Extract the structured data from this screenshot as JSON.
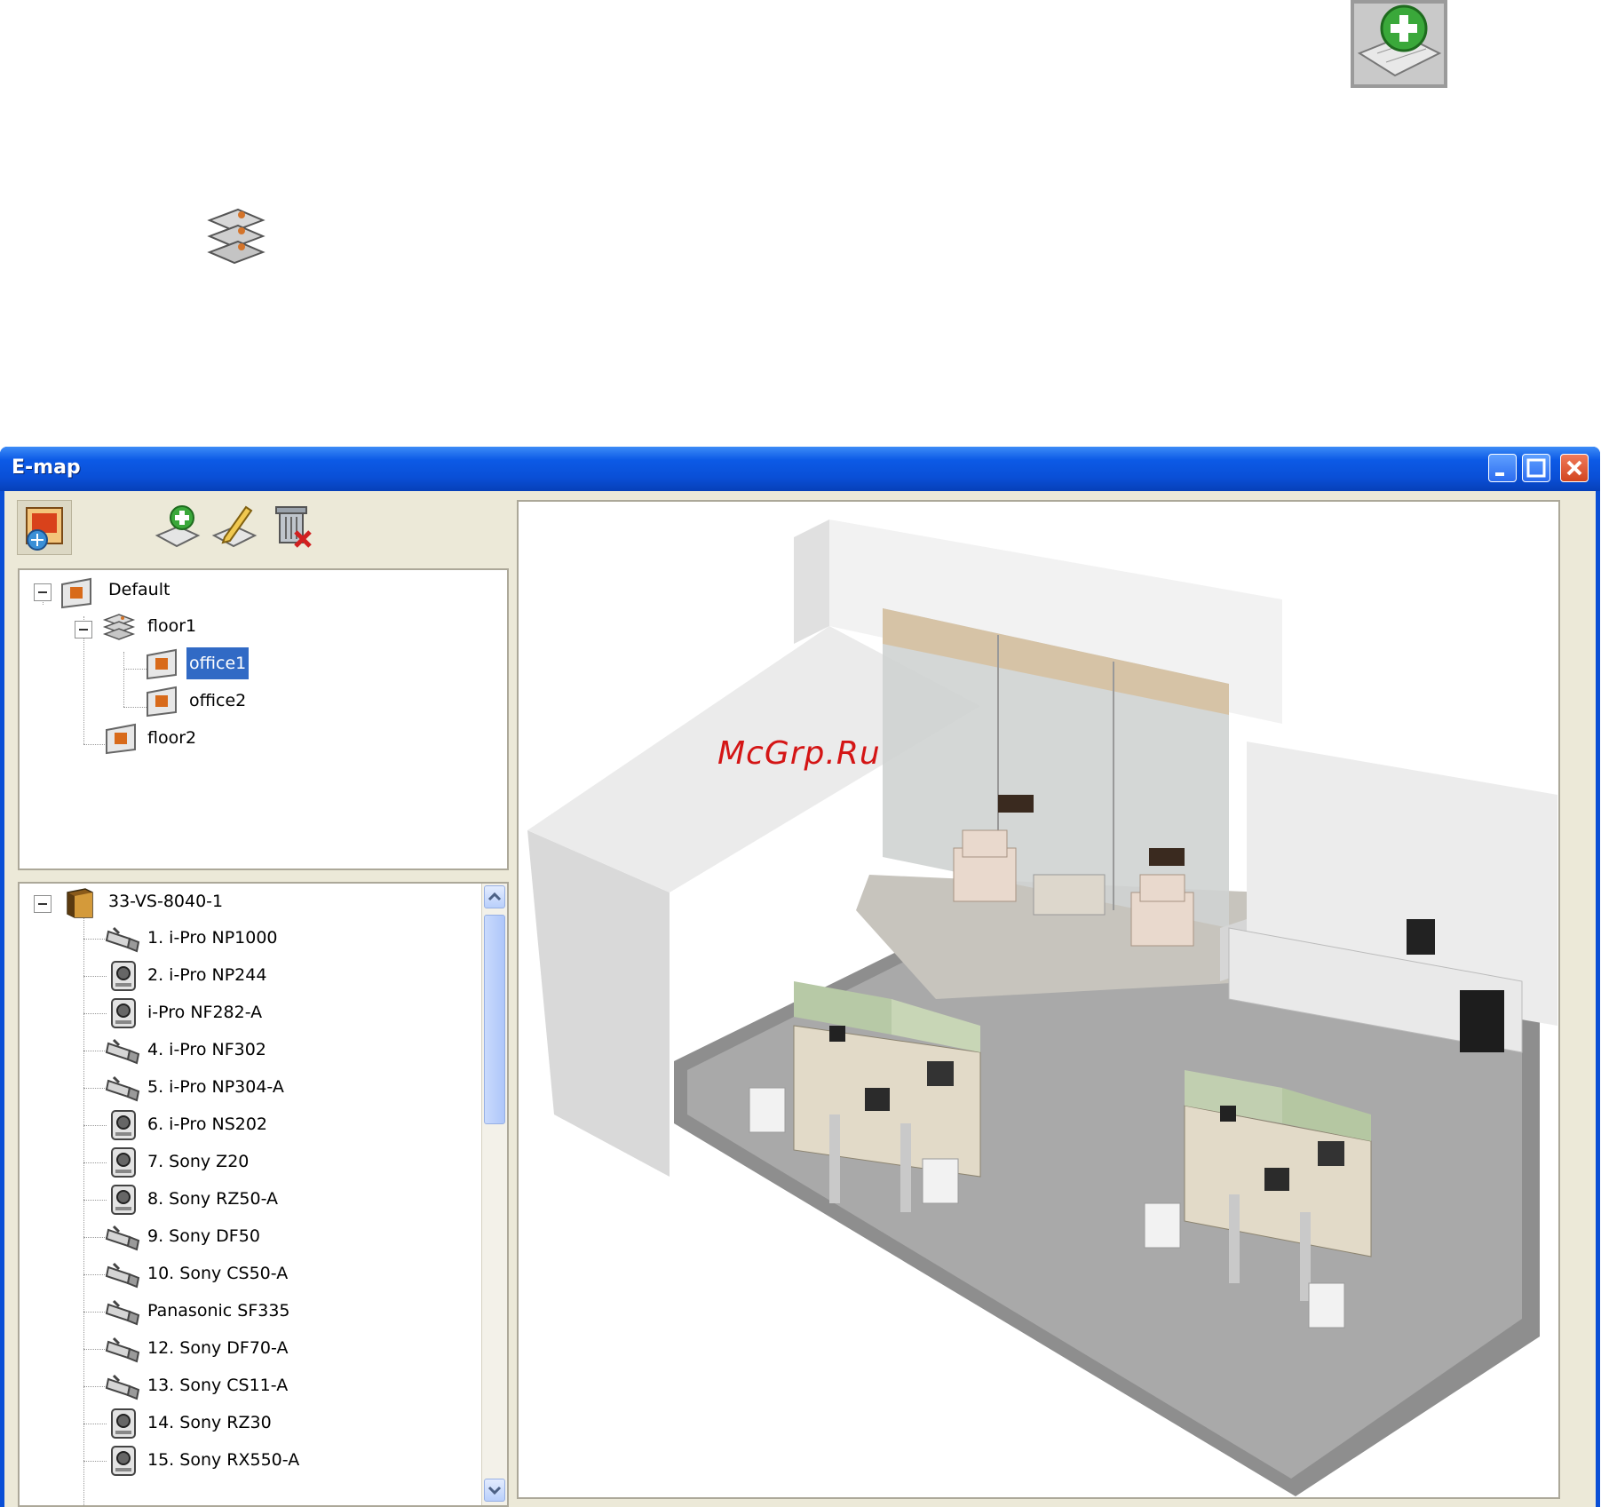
{
  "window": {
    "title": "E-map",
    "min_label": "_",
    "max_label": "□",
    "close_label": "×"
  },
  "toolbar": {
    "icons": [
      "map-view-icon",
      "add-map-icon",
      "edit-map-icon",
      "delete-map-icon"
    ]
  },
  "map_tree": {
    "items": [
      {
        "label": "Default",
        "icon": "map-icon",
        "level": 0,
        "expanded": true
      },
      {
        "label": "floor1",
        "icon": "layers-icon",
        "level": 1,
        "expanded": true
      },
      {
        "label": "office1",
        "icon": "map-icon",
        "level": 2,
        "selected": true
      },
      {
        "label": "office2",
        "icon": "map-icon",
        "level": 2
      },
      {
        "label": "floor2",
        "icon": "map-icon",
        "level": 1
      }
    ]
  },
  "device_tree": {
    "root": {
      "label": "33-VS-8040-1",
      "icon": "server-icon"
    },
    "cameras": [
      {
        "label": "1. i-Pro NP1000",
        "type": "bullet"
      },
      {
        "label": "2. i-Pro NP244",
        "type": "dome"
      },
      {
        "label": "i-Pro NF282-A",
        "type": "dome"
      },
      {
        "label": "4. i-Pro NF302",
        "type": "bullet"
      },
      {
        "label": "5. i-Pro NP304-A",
        "type": "bullet"
      },
      {
        "label": "6. i-Pro NS202",
        "type": "dome"
      },
      {
        "label": "7. Sony Z20",
        "type": "dome"
      },
      {
        "label": "8. Sony RZ50-A",
        "type": "dome"
      },
      {
        "label": "9. Sony DF50",
        "type": "bullet"
      },
      {
        "label": "10. Sony CS50-A",
        "type": "bullet"
      },
      {
        "label": "Panasonic SF335",
        "type": "bullet"
      },
      {
        "label": "12. Sony DF70-A",
        "type": "bullet"
      },
      {
        "label": "13. Sony CS11-A",
        "type": "bullet"
      },
      {
        "label": "14. Sony RZ30",
        "type": "dome"
      },
      {
        "label": "15. Sony RX550-A",
        "type": "dome"
      }
    ]
  },
  "map": {
    "watermark": "McGrp.Ru"
  },
  "colors": {
    "titlebar": "#0a4fd6",
    "selection": "#316ac5",
    "client": "#ece9d8"
  }
}
